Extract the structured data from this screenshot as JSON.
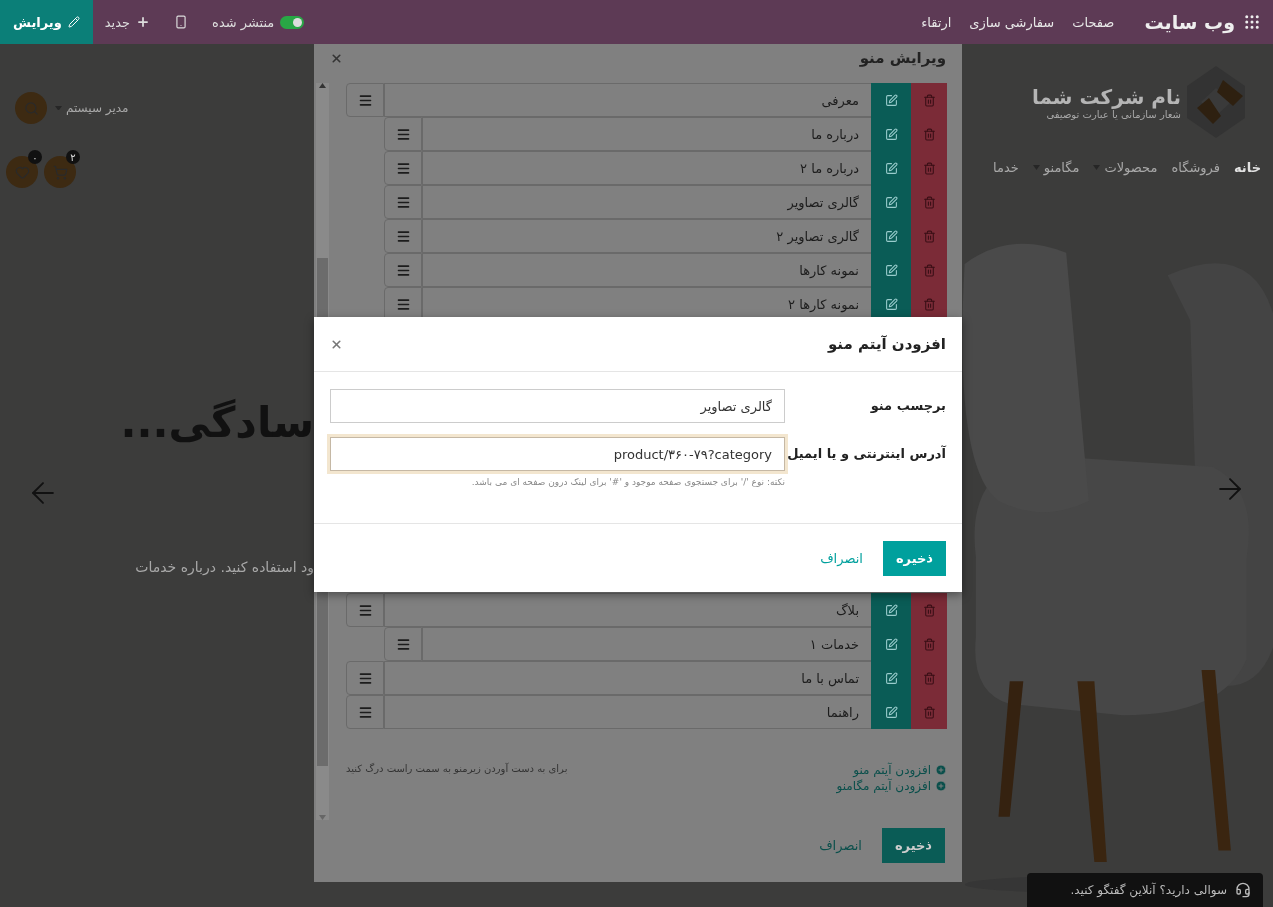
{
  "topbar": {
    "app_title": "وب سایت",
    "menu": [
      "صفحات",
      "سفارشی سازی",
      "ارتقاء"
    ],
    "published": {
      "label": "منتشر شده",
      "on": true
    },
    "new_label": "جدید",
    "edit_label": "ویرایش"
  },
  "site": {
    "company_name": "نام شرکت شما",
    "tagline": "شعار سازمانی یا عبارت توصیفی",
    "user": "مدیر سیستم",
    "wishlist_count": "۰",
    "cart_count": "۲",
    "nav": [
      {
        "label": "خانه",
        "selected": true,
        "dropdown": false
      },
      {
        "label": "فروشگاه",
        "selected": false,
        "dropdown": false
      },
      {
        "label": "محصولات",
        "selected": false,
        "dropdown": true
      },
      {
        "label": "مگامنو",
        "selected": false,
        "dropdown": true
      },
      {
        "label": "خدما",
        "selected": false,
        "dropdown": false
      }
    ],
    "hero_heading": "سادگی...",
    "hero_text": "ود استفاده کنید. درباره خدمات"
  },
  "chat": {
    "text": "سوالی دارید؟ آنلاین گفتگو کنید."
  },
  "edit_menu": {
    "title": "ویرایش منو",
    "items": [
      {
        "label": "معرفی",
        "children": [
          {
            "label": "درباره ما"
          },
          {
            "label": "درباره ما ۲"
          },
          {
            "label": "گالری تصاویر"
          },
          {
            "label": "گالری تصاویر ۲"
          },
          {
            "label": "نمونه کارها"
          },
          {
            "label": "نمونه کارها ۲"
          }
        ]
      },
      {
        "label": "بلاگ",
        "children": [
          {
            "label": "خدمات ۱"
          }
        ]
      },
      {
        "label": "تماس با ما"
      },
      {
        "label": "راهنما"
      }
    ],
    "add_links": [
      "افزودن آیتم منو",
      "افزودن آیتم مگامنو"
    ],
    "hint": "برای به دست آوردن زیرمنو به سمت راست درگ کنید",
    "save": "ذخیره",
    "cancel": "انصراف"
  },
  "add_dialog": {
    "title": "افزودن آیتم منو",
    "fields": [
      {
        "label": "برچسب منو",
        "value": "گالری تصاویر",
        "focused": false
      },
      {
        "label": "آدرس اینترنتی و یا ایمیل",
        "value": "product/۳۶۰-۷۹?category",
        "focused": true
      }
    ],
    "note": "نکته: نوع '/' برای جستجوی صفحه موجود و '#' برای لینک درون صفحه ای می باشد.",
    "save": "ذخیره",
    "cancel": "انصراف"
  }
}
